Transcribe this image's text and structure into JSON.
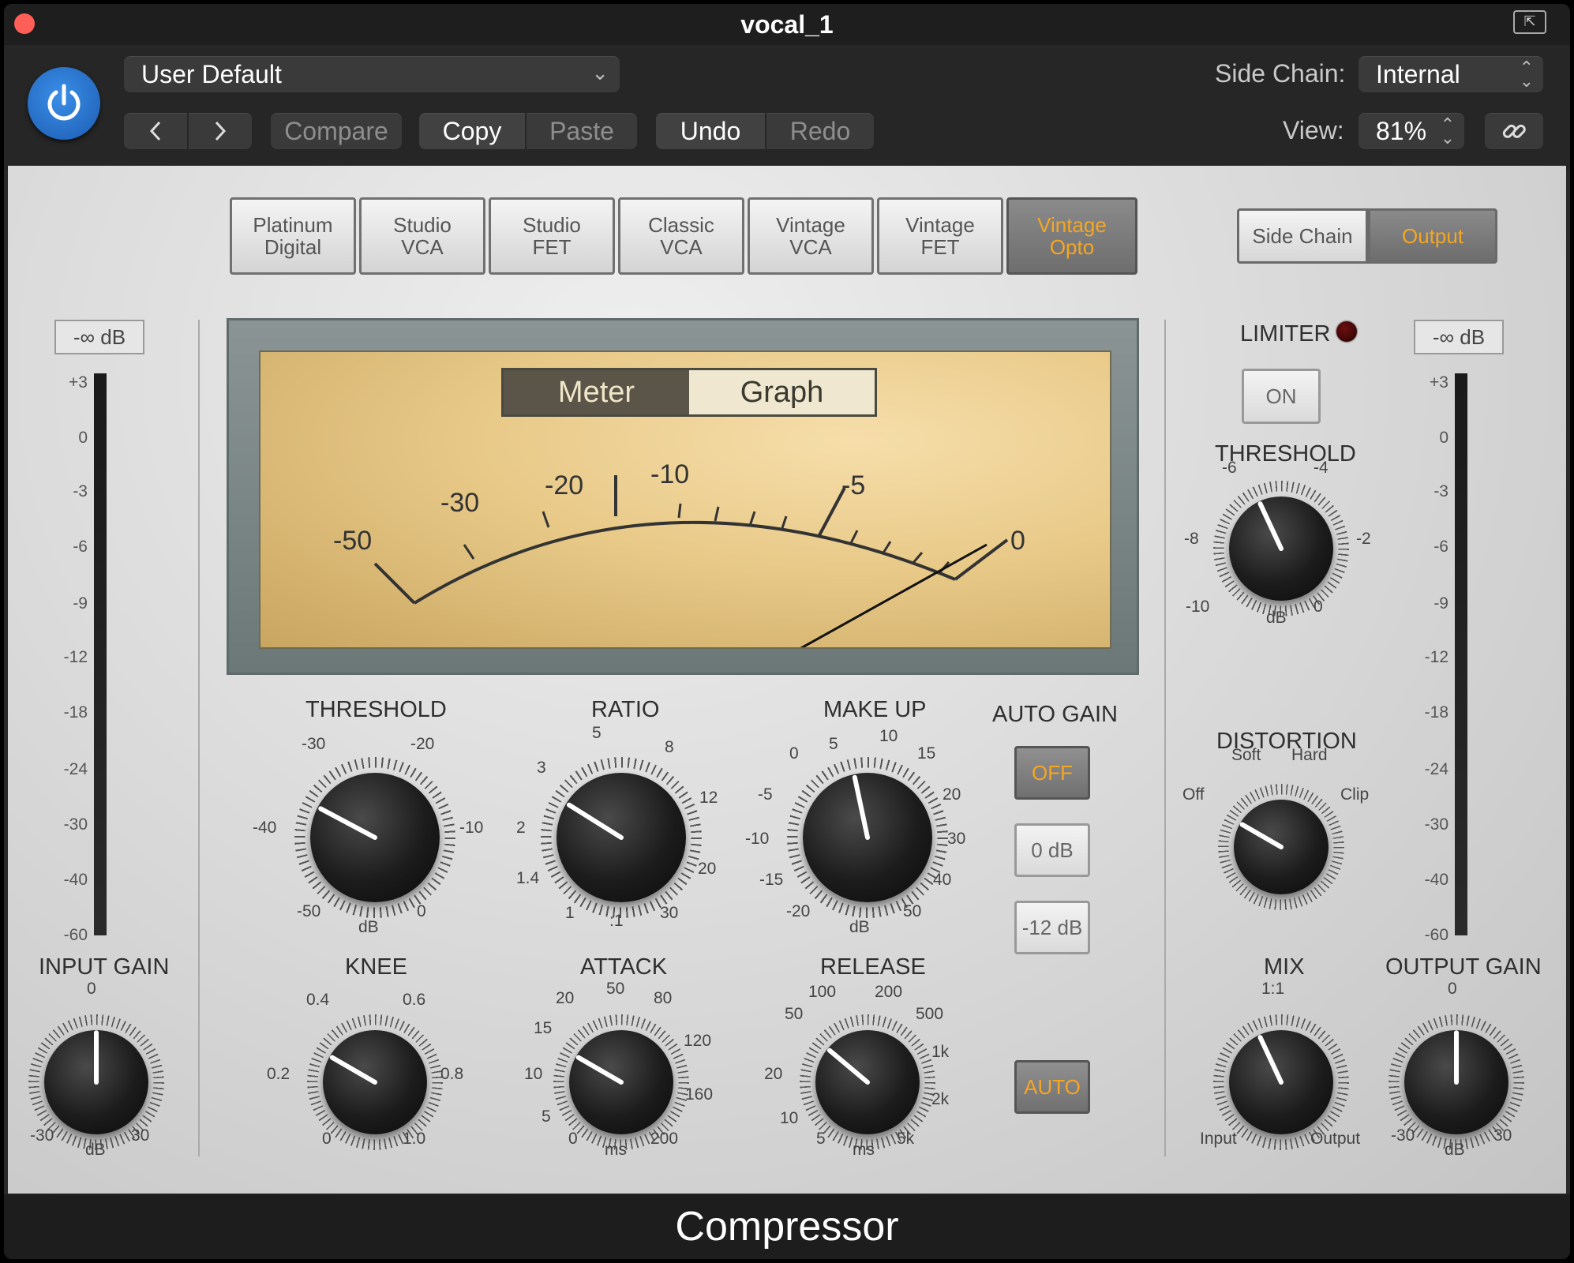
{
  "window": {
    "title": "vocal_1",
    "plugin_name": "Compressor"
  },
  "toolbar": {
    "preset": "User Default",
    "compare": "Compare",
    "copy": "Copy",
    "paste": "Paste",
    "undo": "Undo",
    "redo": "Redo",
    "side_chain_label": "Side Chain:",
    "side_chain_value": "Internal",
    "view_label": "View:",
    "view_value": "81%"
  },
  "models": [
    {
      "l1": "Platinum",
      "l2": "Digital"
    },
    {
      "l1": "Studio",
      "l2": "VCA"
    },
    {
      "l1": "Studio",
      "l2": "FET"
    },
    {
      "l1": "Classic",
      "l2": "VCA"
    },
    {
      "l1": "Vintage",
      "l2": "VCA"
    },
    {
      "l1": "Vintage",
      "l2": "FET"
    },
    {
      "l1": "Vintage",
      "l2": "Opto"
    }
  ],
  "active_model": "Vintage Opto",
  "accent_color": "#f5a623",
  "view_tabs": {
    "side_chain": "Side Chain",
    "output": "Output",
    "active": "Output"
  },
  "meter": {
    "toggle": {
      "meter": "Meter",
      "graph": "Graph",
      "active": "Meter"
    },
    "scale": [
      "-50",
      "-30",
      "-20",
      "-10",
      "-5",
      "0"
    ]
  },
  "input_meter": {
    "readout": "-∞ dB",
    "scale": [
      "+3",
      "0",
      "-3",
      "-6",
      "-9",
      "-12",
      "-18",
      "-24",
      "-30",
      "-40",
      "-60"
    ]
  },
  "output_meter": {
    "readout": "-∞ dB",
    "scale": [
      "+3",
      "0",
      "-3",
      "-6",
      "-9",
      "-12",
      "-18",
      "-24",
      "-30",
      "-40",
      "-60"
    ]
  },
  "knobs": {
    "threshold": {
      "title": "THRESHOLD",
      "ticks": [
        "-30",
        "-20",
        "-40",
        "-10",
        "-50",
        "dB",
        "0"
      ]
    },
    "ratio": {
      "title": "RATIO",
      "ticks": [
        "5",
        "8",
        "3",
        "12",
        "2",
        "1.4",
        "20",
        "1",
        ":1",
        "30"
      ]
    },
    "makeup": {
      "title": "MAKE UP",
      "ticks": [
        "5",
        "10",
        "0",
        "15",
        "-5",
        "20",
        "-10",
        "30",
        "-15",
        "40",
        "-20",
        "dB",
        "50"
      ]
    },
    "knee": {
      "title": "KNEE",
      "ticks": [
        "0.4",
        "0.6",
        "0.2",
        "0.8",
        "0",
        "1.0"
      ]
    },
    "attack": {
      "title": "ATTACK",
      "ticks": [
        "50",
        "20",
        "80",
        "15",
        "120",
        "10",
        "160",
        "5",
        "0",
        "ms",
        "200"
      ]
    },
    "release": {
      "title": "RELEASE",
      "ticks": [
        "100",
        "200",
        "50",
        "500",
        "1k",
        "20",
        "2k",
        "10",
        "5",
        "ms",
        "5k"
      ]
    },
    "input_gain": {
      "title": "INPUT GAIN",
      "ticks": [
        "0",
        "-30",
        "dB",
        "30"
      ]
    },
    "output_gain": {
      "title": "OUTPUT GAIN",
      "ticks": [
        "0",
        "-30",
        "dB",
        "30"
      ]
    },
    "limiter_threshold": {
      "title": "THRESHOLD",
      "ticks": [
        "-6",
        "-4",
        "-8",
        "-2",
        "-10",
        "dB",
        "0"
      ]
    },
    "distortion": {
      "title": "DISTORTION",
      "ticks": [
        "Soft",
        "Hard",
        "Off",
        "Clip"
      ]
    },
    "mix": {
      "title": "MIX",
      "ticks": [
        "1:1",
        "Input",
        "Output"
      ]
    }
  },
  "auto_gain": {
    "title": "AUTO GAIN",
    "off": "OFF",
    "zero": "0 dB",
    "minus12": "-12 dB",
    "auto": "AUTO"
  },
  "limiter": {
    "title": "LIMITER",
    "on": "ON"
  }
}
